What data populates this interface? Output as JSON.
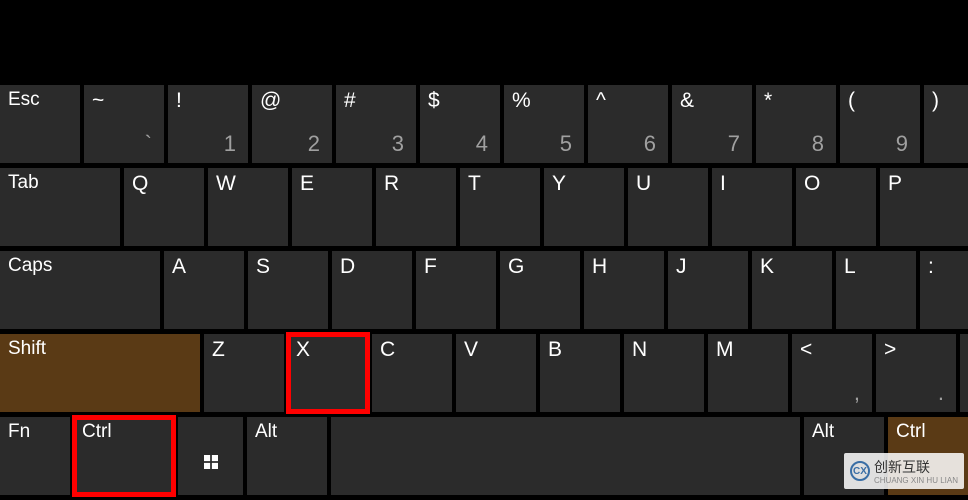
{
  "row1": {
    "esc": "Esc",
    "keys": [
      {
        "p": "~",
        "s": "`"
      },
      {
        "p": "!",
        "s": "1"
      },
      {
        "p": "@",
        "s": "2"
      },
      {
        "p": "#",
        "s": "3"
      },
      {
        "p": "$",
        "s": "4"
      },
      {
        "p": "%",
        "s": "5"
      },
      {
        "p": "^",
        "s": "6"
      },
      {
        "p": "&",
        "s": "7"
      },
      {
        "p": "*",
        "s": "8"
      },
      {
        "p": "(",
        "s": "9"
      },
      {
        "p": ")",
        "s": ""
      }
    ]
  },
  "row2": {
    "tab": "Tab",
    "keys": [
      "Q",
      "W",
      "E",
      "R",
      "T",
      "Y",
      "U",
      "I",
      "O",
      "P"
    ]
  },
  "row3": {
    "caps": "Caps",
    "keys": [
      "A",
      "S",
      "D",
      "F",
      "G",
      "H",
      "J",
      "K",
      "L",
      ":"
    ]
  },
  "row4": {
    "shift": "Shift",
    "keys": [
      "Z",
      "X",
      "C",
      "V",
      "B",
      "N",
      "M"
    ],
    "punct": [
      {
        "p": "<",
        "s": ","
      },
      {
        "p": ">",
        "s": "."
      }
    ]
  },
  "row5": {
    "fn": "Fn",
    "ctrl": "Ctrl",
    "alt": "Alt",
    "alt2": "Alt",
    "ctrl2": "Ctrl"
  },
  "watermark": {
    "brand": "创新互联",
    "sub": "CHUANG XIN HU LIAN"
  }
}
